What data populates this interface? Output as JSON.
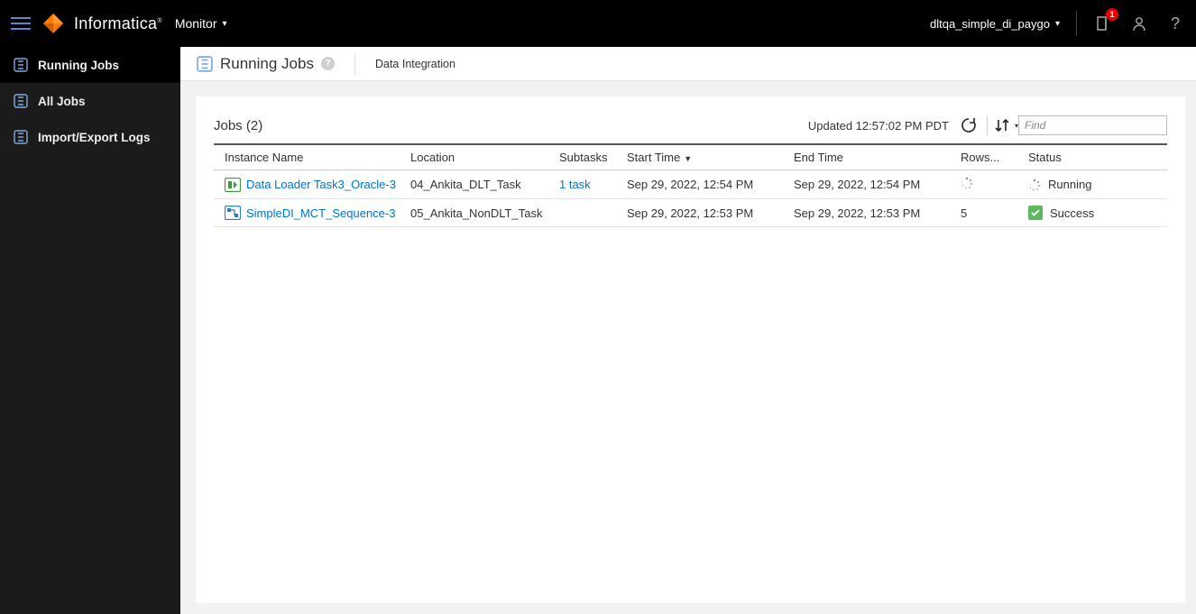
{
  "header": {
    "brand": "Informatica",
    "app_name": "Monitor",
    "org_name": "dltqa_simple_di_paygo",
    "notif_count": "1"
  },
  "sidebar": {
    "items": [
      {
        "label": "Running Jobs",
        "active": true
      },
      {
        "label": "All Jobs",
        "active": false
      },
      {
        "label": "Import/Export Logs",
        "active": false
      }
    ]
  },
  "page": {
    "title": "Running Jobs",
    "context": "Data Integration"
  },
  "jobs": {
    "title": "Jobs (2)",
    "updated_text": "Updated 12:57:02 PM PDT",
    "find_placeholder": "Find",
    "columns": {
      "instance": "Instance Name",
      "location": "Location",
      "subtasks": "Subtasks",
      "start": "Start Time",
      "end": "End Time",
      "rows": "Rows...",
      "status": "Status"
    },
    "rows": [
      {
        "icon": "data-loader",
        "instance": "Data Loader Task3_Oracle-3",
        "location": "04_Ankita_DLT_Task",
        "subtasks": "1 task",
        "subtasks_link": true,
        "start": "Sep 29, 2022, 12:54 PM",
        "end": "Sep 29, 2022, 12:54 PM",
        "rows_value": "",
        "rows_spinner": true,
        "status": "Running",
        "status_icon": "spinner"
      },
      {
        "icon": "taskflow",
        "instance": "SimpleDI_MCT_Sequence-3",
        "location": "05_Ankita_NonDLT_Task",
        "subtasks": "",
        "subtasks_link": false,
        "start": "Sep 29, 2022, 12:53 PM",
        "end": "Sep 29, 2022, 12:53 PM",
        "rows_value": "5",
        "rows_spinner": false,
        "status": "Success",
        "status_icon": "check"
      }
    ]
  }
}
